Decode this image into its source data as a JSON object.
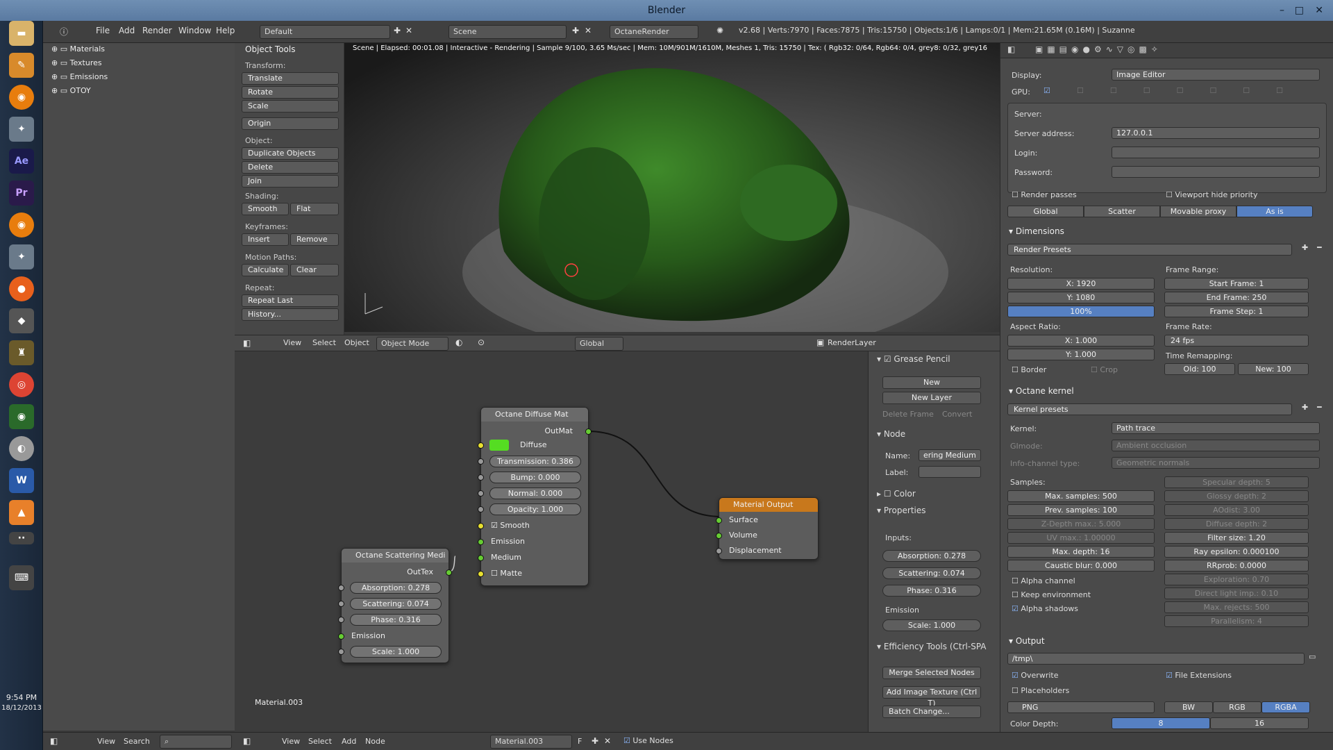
{
  "window": {
    "title": "Blender"
  },
  "menu": {
    "items": [
      "File",
      "Add",
      "Render",
      "Window",
      "Help"
    ],
    "layout": "Default",
    "scene": "Scene",
    "engine": "OctaneRender",
    "stats": "v2.68 | Verts:7970 | Faces:7875 | Tris:15750 | Objects:1/6 | Lamps:0/1 | Mem:21.65M (0.16M) | Suzanne"
  },
  "outliner": {
    "items": [
      "Materials",
      "Textures",
      "Emissions",
      "OTOY"
    ]
  },
  "tools": {
    "title": "Object Tools",
    "transform": "Transform:",
    "translate": "Translate",
    "rotate": "Rotate",
    "scale": "Scale",
    "origin": "Origin",
    "object": "Object:",
    "duplicate": "Duplicate Objects",
    "delete": "Delete",
    "join": "Join",
    "shading": "Shading:",
    "smooth": "Smooth",
    "flat": "Flat",
    "keyframes": "Keyframes:",
    "insert": "Insert",
    "remove": "Remove",
    "motion": "Motion Paths:",
    "calculate": "Calculate",
    "clear": "Clear",
    "repeat": "Repeat:",
    "repeat_last": "Repeat Last",
    "history": "History..."
  },
  "viewport": {
    "status": "Scene | Elapsed: 00:01.08 | Interactive - Rendering | Sample 9/100, 3.65 Ms/sec | Mem: 10M/901M/1610M, Meshes 1, Tris: 15750 | Tex: ( Rgb32: 0/64, Rgb64: 0/4, grey8: 0/32, grey16"
  },
  "vp_header": {
    "view": "View",
    "select": "Select",
    "object": "Object",
    "mode": "Object Mode",
    "orientation": "Global",
    "layer": "RenderLayer"
  },
  "nodes": {
    "diffuse": {
      "title": "Octane Diffuse Mat",
      "out": "OutMat",
      "diffuse": "Diffuse",
      "transmission": "Transmission: 0.386",
      "bump": "Bump: 0.000",
      "normal": "Normal: 0.000",
      "opacity": "Opacity: 1.000",
      "smooth": "Smooth",
      "emission": "Emission",
      "medium": "Medium",
      "matte": "Matte",
      "diffuse_color": "#55dd22"
    },
    "scatter": {
      "title": "Octane Scattering Medi",
      "out": "OutTex",
      "absorption": "Absorption: 0.278",
      "scattering": "Scattering: 0.074",
      "phase": "Phase: 0.316",
      "emission": "Emission",
      "scale": "Scale: 1.000"
    },
    "output": {
      "title": "Material Output",
      "surface": "Surface",
      "volume": "Volume",
      "displacement": "Displacement"
    },
    "material_label": "Material.003"
  },
  "node_side": {
    "grease": "Grease Pencil",
    "new": "New",
    "new_layer": "New Layer",
    "delete_frame": "Delete Frame",
    "convert": "Convert",
    "node": "Node",
    "name": "Name:",
    "name_val": "ering Medium",
    "label": "Label:",
    "color": "Color",
    "properties": "Properties",
    "inputs": "Inputs:",
    "absorption": "Absorption: 0.278",
    "scattering": "Scattering: 0.074",
    "phase": "Phase: 0.316",
    "emission": "Emission",
    "scale": "Scale: 1.000",
    "eff": "Efficiency Tools (Ctrl-SPA",
    "merge": "Merge Selected Nodes",
    "add_image": "Add Image Texture (Ctrl T)",
    "batch": "Batch Change..."
  },
  "props": {
    "display": "Display:",
    "display_val": "Image Editor",
    "gpu": "GPU:",
    "server": "Server:",
    "server_addr": "Server address:",
    "server_val": "127.0.0.1",
    "login": "Login:",
    "password": "Password:",
    "render_passes": "Render passes",
    "vp_hide": "Viewport hide priority",
    "tabs": [
      "Global",
      "Scatter",
      "Movable proxy",
      "As is"
    ],
    "dimensions": "Dimensions",
    "render_presets": "Render Presets",
    "resolution": "Resolution:",
    "x": "X: 1920",
    "y": "Y: 1080",
    "pct": "100%",
    "frame_range": "Frame Range:",
    "start": "Start Frame: 1",
    "end": "End Frame: 250",
    "step": "Frame Step: 1",
    "aspect": "Aspect Ratio:",
    "ax": "X: 1.000",
    "ay": "Y: 1.000",
    "frame_rate": "Frame Rate:",
    "fps": "24 fps",
    "time_remap": "Time Remapping:",
    "old": "Old: 100",
    "new": "New: 100",
    "border": "Border",
    "crop": "Crop",
    "kernel": "Octane kernel",
    "kernel_presets": "Kernel presets",
    "kernel_l": "Kernel:",
    "kernel_val": "Path trace",
    "gimode": "GImode:",
    "gimode_val": "Ambient occlusion",
    "info": "Info-channel type:",
    "info_val": "Geometric normals",
    "samples": "Samples:",
    "left": [
      "Max. samples: 500",
      "Prev. samples: 100",
      "Z-Depth max.: 5.000",
      "UV max.: 1.00000",
      "Max. depth: 16",
      "Caustic blur: 0.000"
    ],
    "right": [
      "Specular depth: 5",
      "Glossy depth: 2",
      "AOdist: 3.00",
      "Diffuse depth: 2",
      "Filter size: 1.20",
      "Ray epsilon: 0.000100",
      "RRprob: 0.0000",
      "Exploration: 0.70",
      "Direct light imp.: 0.10",
      "Max. rejects: 500",
      "Parallelism: 4"
    ],
    "alpha_channel": "Alpha channel",
    "keep_env": "Keep environment",
    "alpha_shadows": "Alpha shadows",
    "output": "Output",
    "path": "/tmp\\",
    "overwrite": "Overwrite",
    "file_ext": "File Extensions",
    "placeholders": "Placeholders",
    "format": "PNG",
    "bw": "BW",
    "rgb": "RGB",
    "rgba": "RGBA",
    "color_depth": "Color Depth:",
    "d8": "8",
    "d16": "16"
  },
  "bottom": {
    "view": "View",
    "search": "Search",
    "view2": "View",
    "select": "Select",
    "add": "Add",
    "node": "Node",
    "material": "Material.003",
    "f": "F",
    "use_nodes": "Use Nodes"
  },
  "clock": {
    "time": "9:54 PM",
    "date": "18/12/2013"
  }
}
